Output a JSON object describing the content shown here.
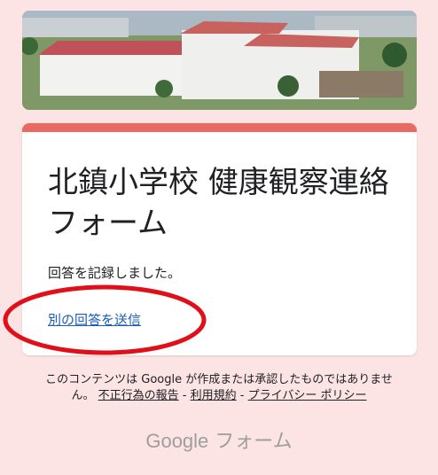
{
  "form": {
    "title": "北鎮小学校 健康観察連絡フォーム",
    "confirmation": "回答を記録しました。",
    "submit_another": "別の回答を送信"
  },
  "footer": {
    "text": "このコンテンツは Google が作成または承認したものではありません。",
    "report": "不正行為の報告",
    "sep1": " - ",
    "terms": "利用規約",
    "sep2": " - ",
    "privacy": "プライバシー ポリシー"
  },
  "brand": {
    "google": "Google",
    "forms": "フォーム"
  },
  "colors": {
    "accent": "#ea6a63",
    "background": "#fce4e4",
    "link": "#1a5fb4",
    "annotation": "#e0101a"
  }
}
